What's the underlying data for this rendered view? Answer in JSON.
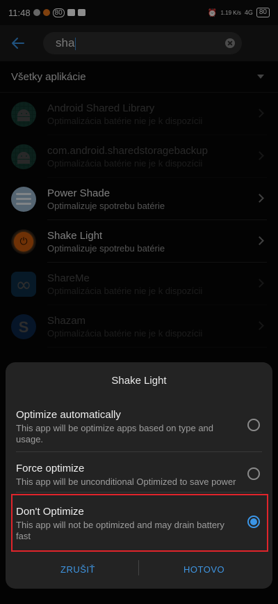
{
  "status_bar": {
    "time": "11:48",
    "badge": "80",
    "net_speed": "1.19 K/s",
    "signal": "4G",
    "battery": "80"
  },
  "search": {
    "query": "sha"
  },
  "section": {
    "label": "Všetky aplikácie"
  },
  "apps": [
    {
      "name": "Android Shared Library",
      "status": "Optimalizácia batérie nie je k dispozícii",
      "icon": "android-icon"
    },
    {
      "name": "com.android.sharedstoragebackup",
      "status": "Optimalizácia batérie nie je k dispozícii",
      "icon": "android-icon"
    },
    {
      "name": "Power Shade",
      "status": "Optimalizuje spotrebu batérie",
      "icon": "power-shade-icon"
    },
    {
      "name": "Shake Light",
      "status": "Optimalizuje spotrebu batérie",
      "icon": "flashlight-icon"
    },
    {
      "name": "ShareMe",
      "status": "Optimalizácia batérie nie je k dispozícii",
      "icon": "shareme-icon"
    },
    {
      "name": "Shazam",
      "status": "Optimalizácia batérie nie je k dispozícii",
      "icon": "shazam-icon"
    }
  ],
  "dialog": {
    "title": "Shake Light",
    "options": [
      {
        "title": "Optimize automatically",
        "desc": "This app will be optimize apps based on type and usage.",
        "selected": false
      },
      {
        "title": "Force optimize",
        "desc": "This app will be unconditional Optimized to save power",
        "selected": false
      },
      {
        "title": "Don't Optimize",
        "desc": "This app will not be optimized and may drain battery fast",
        "selected": true
      }
    ],
    "cancel_label": "ZRUŠIŤ",
    "done_label": "HOTOVO"
  },
  "colors": {
    "accent": "#3b95e6",
    "highlight": "#e0242b"
  }
}
